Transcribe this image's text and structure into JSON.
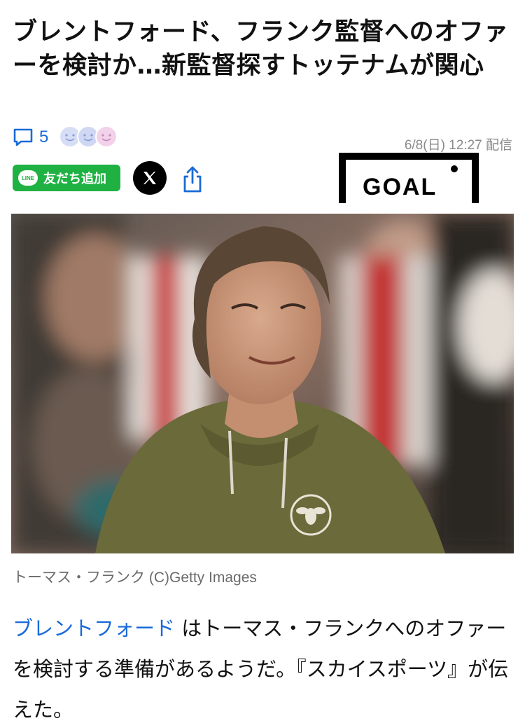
{
  "article": {
    "headline": "ブレントフォード、フランク監督へのオファーを検討か…新監督探すトッテナムが関心",
    "comment_count": "5",
    "pub_date": "6/8(日) 12:27 配信",
    "source_logo_text": "GOAL",
    "photo_caption": "トーマス・フランク (C)Getty Images",
    "body_link_text": "ブレントフォード",
    "body_text": "はトーマス・フランクへのオファーを検討する準備があるようだ。『スカイスポーツ』が伝えた。"
  },
  "share": {
    "line_label": "友だち追加",
    "line_logo_text": "LINE",
    "x_icon": "x-logo-icon",
    "share_icon": "share-icon"
  },
  "reactions": {
    "face_colors": [
      "#d6def5",
      "#cfd7f2",
      "#f2d2ea"
    ]
  },
  "colors": {
    "link": "#1a6ad9",
    "line_green": "#1fb142",
    "hoodie": "#6b6a3a"
  }
}
